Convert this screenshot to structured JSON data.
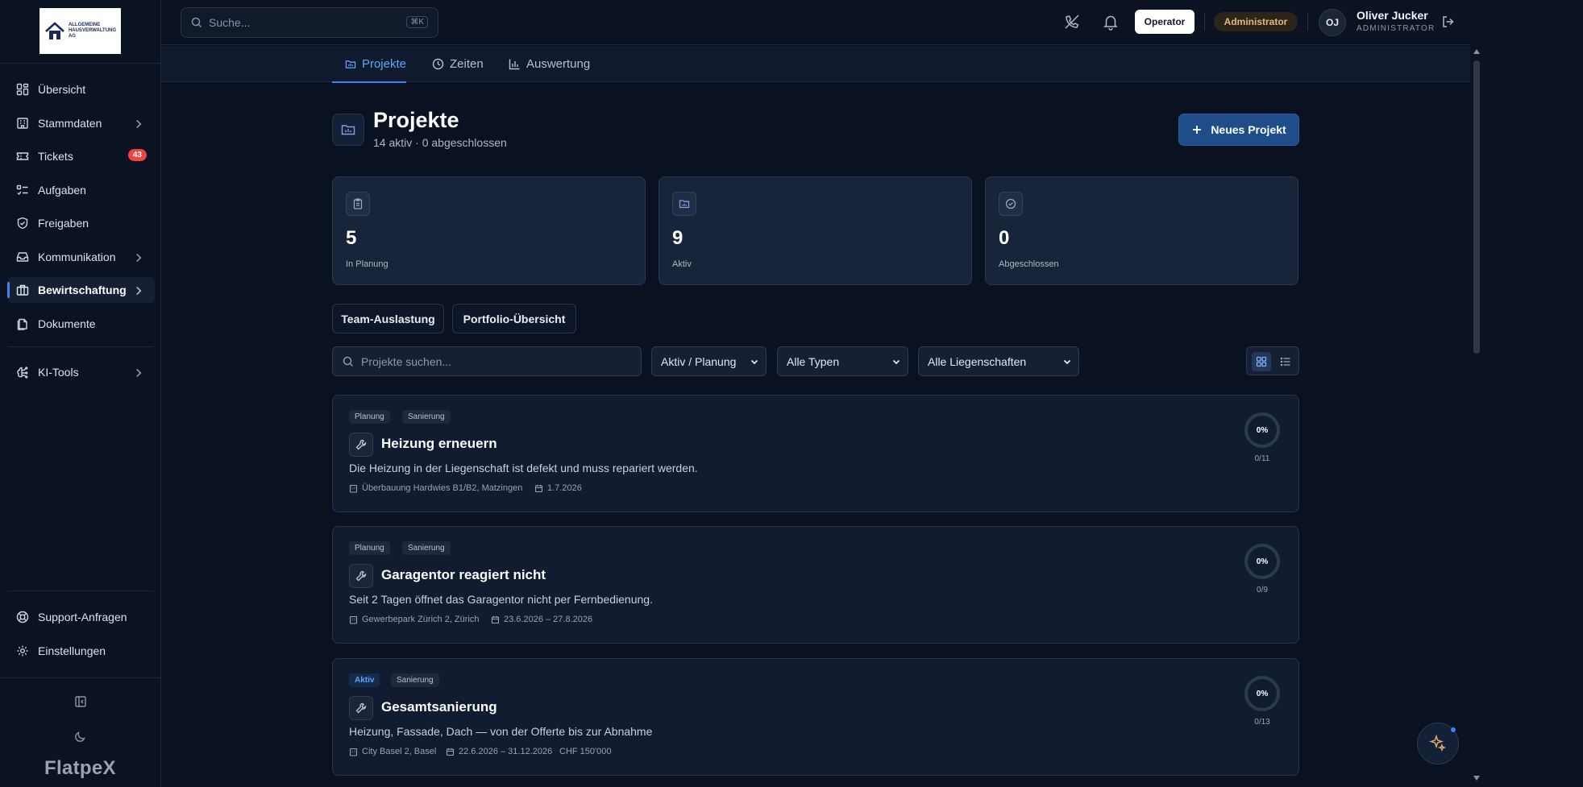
{
  "logo": {
    "line1": "ALLGEMEINE",
    "line2": "HAUSVERWALTUNG",
    "line3": "AG"
  },
  "sidebar": {
    "items": [
      {
        "label": "Übersicht",
        "icon": "grid-icon"
      },
      {
        "label": "Stammdaten",
        "icon": "building-icon"
      },
      {
        "label": "Tickets",
        "icon": "ticket-icon",
        "badge": "43"
      },
      {
        "label": "Aufgaben",
        "icon": "checklist-icon"
      },
      {
        "label": "Freigaben",
        "icon": "shield-check-icon"
      },
      {
        "label": "Kommunikation",
        "icon": "inbox-icon"
      },
      {
        "label": "Bewirtschaftung",
        "icon": "briefcase-icon"
      },
      {
        "label": "Dokumente",
        "icon": "document-icon"
      },
      {
        "label": "KI-Tools",
        "icon": "ai-brain-icon"
      }
    ],
    "bottom_items": [
      {
        "label": "Support-Anfragen",
        "icon": "lifebuoy-icon"
      },
      {
        "label": "Einstellungen",
        "icon": "gear-icon"
      }
    ],
    "brand": "FlatpeX"
  },
  "topbar": {
    "search_placeholder": "Suche...",
    "search_shortcut": "⌘K",
    "operator_label": "Operator",
    "role_badge": "Administrator",
    "avatar_initials": "OJ",
    "user_name": "Oliver Jucker",
    "user_role": "ADMINISTRATOR"
  },
  "subnav": {
    "tabs": [
      {
        "label": "Projekte",
        "active": true
      },
      {
        "label": "Zeiten",
        "active": false
      },
      {
        "label": "Auswertung",
        "active": false
      }
    ]
  },
  "page": {
    "title": "Projekte",
    "subtitle": "14 aktiv · 0 abgeschlossen",
    "new_button": "Neues Projekt"
  },
  "stats": [
    {
      "value": "5",
      "label": "In Planung"
    },
    {
      "value": "9",
      "label": "Aktiv"
    },
    {
      "value": "0",
      "label": "Abgeschlossen"
    }
  ],
  "actions": {
    "team_label": "Team-Auslastung",
    "portfolio_label": "Portfolio-Übersicht"
  },
  "filters": {
    "search_placeholder": "Projekte suchen...",
    "status": "Aktiv / Planung",
    "type": "Alle Typen",
    "property": "Alle Liegenschaften"
  },
  "projects": [
    {
      "status": "Planung",
      "type": "Sanierung",
      "title": "Heizung erneuern",
      "description": "Die Heizung in der Liegenschaft ist defekt und muss repariert werden.",
      "location": "Überbauung Hardwies B1/B2, Matzingen",
      "date": "1.7.2026",
      "budget": "",
      "progress_label": "0%",
      "progress": 0,
      "tasks": "0/11"
    },
    {
      "status": "Planung",
      "type": "Sanierung",
      "title": "Garagentor reagiert nicht",
      "description": "Seit 2 Tagen öffnet das Garagentor nicht per Fernbedienung.",
      "location": "Gewerbepark Zürich 2, Zürich",
      "date": "23.6.2026 – 27.8.2026",
      "budget": "",
      "progress_label": "0%",
      "progress": 0,
      "tasks": "0/9"
    },
    {
      "status": "Aktiv",
      "type": "Sanierung",
      "title": "Gesamtsanierung",
      "description": "Heizung, Fassade, Dach — von der Offerte bis zur Abnahme",
      "location": "City Basel 2, Basel",
      "date": "22.6.2026 – 31.12.2026",
      "budget": "CHF 150'000",
      "progress_label": "0%",
      "progress": 0,
      "tasks": "0/13"
    }
  ],
  "colors": {
    "accent": "#3b82f6",
    "background": "#0a1120",
    "badge_red": "#ef4444",
    "admin_badge": "#e3b877"
  }
}
